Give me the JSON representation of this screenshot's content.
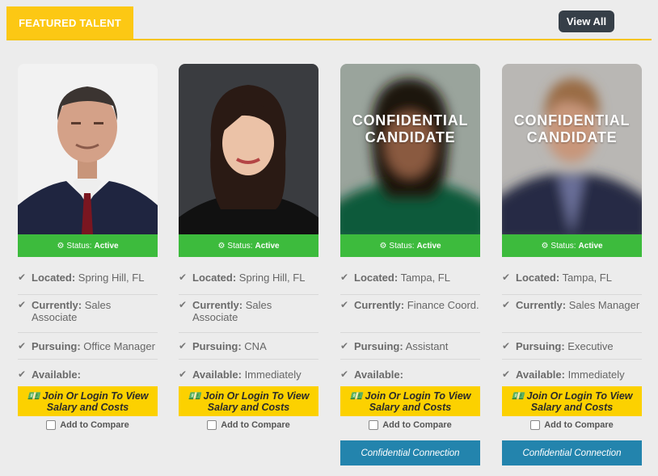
{
  "header": {
    "tab_label": "FEATURED TALENT",
    "view_all_label": "View All"
  },
  "cards": [
    {
      "status_label": "Status:",
      "status_value": "Active",
      "located_label": "Located:",
      "located": "Spring Hill, FL",
      "currently_label": "Currently:",
      "currently": "Sales Associate",
      "pursuing_label": "Pursuing:",
      "pursuing": "Office Manager",
      "available_label": "Available:",
      "available": "",
      "join_line1": "Join Or Login To View",
      "join_line2": "Salary and Costs",
      "compare_label": "Add to Compare"
    },
    {
      "status_label": "Status:",
      "status_value": "Active",
      "located_label": "Located:",
      "located": "Spring Hill, FL",
      "currently_label": "Currently:",
      "currently": "Sales Associate",
      "pursuing_label": "Pursuing:",
      "pursuing": "CNA",
      "available_label": "Available:",
      "available": "Immediately",
      "join_line1": "Join Or Login To View",
      "join_line2": "Salary and Costs",
      "compare_label": "Add to Compare"
    },
    {
      "confidential_line1": "CONFIDENTIAL",
      "confidential_line2": "CANDIDATE",
      "status_label": "Status:",
      "status_value": "Active",
      "located_label": "Located:",
      "located": "Tampa, FL",
      "currently_label": "Currently:",
      "currently": "Finance Coord.",
      "pursuing_label": "Pursuing:",
      "pursuing": "Assistant",
      "available_label": "Available:",
      "available": "",
      "join_line1": "Join Or Login To View",
      "join_line2": "Salary and Costs",
      "compare_label": "Add to Compare",
      "connection_label": "Confidential Connection"
    },
    {
      "confidential_line1": "CONFIDENTIAL",
      "confidential_line2": "CANDIDATE",
      "status_label": "Status:",
      "status_value": "Active",
      "located_label": "Located:",
      "located": "Tampa, FL",
      "currently_label": "Currently:",
      "currently": "Sales Manager",
      "pursuing_label": "Pursuing:",
      "pursuing": "Executive",
      "available_label": "Available:",
      "available": "Immediately",
      "join_line1": "Join Or Login To View",
      "join_line2": "Salary and Costs",
      "compare_label": "Add to Compare",
      "connection_label": "Confidential Connection"
    }
  ],
  "colors": {
    "accent": "#fcc814",
    "status_green": "#3dbb3d",
    "connection_blue": "#2384ad",
    "button_dark": "#363f48"
  },
  "icons": {
    "status": "gears-icon",
    "field": "shield-check-icon",
    "join": "money-icon"
  }
}
